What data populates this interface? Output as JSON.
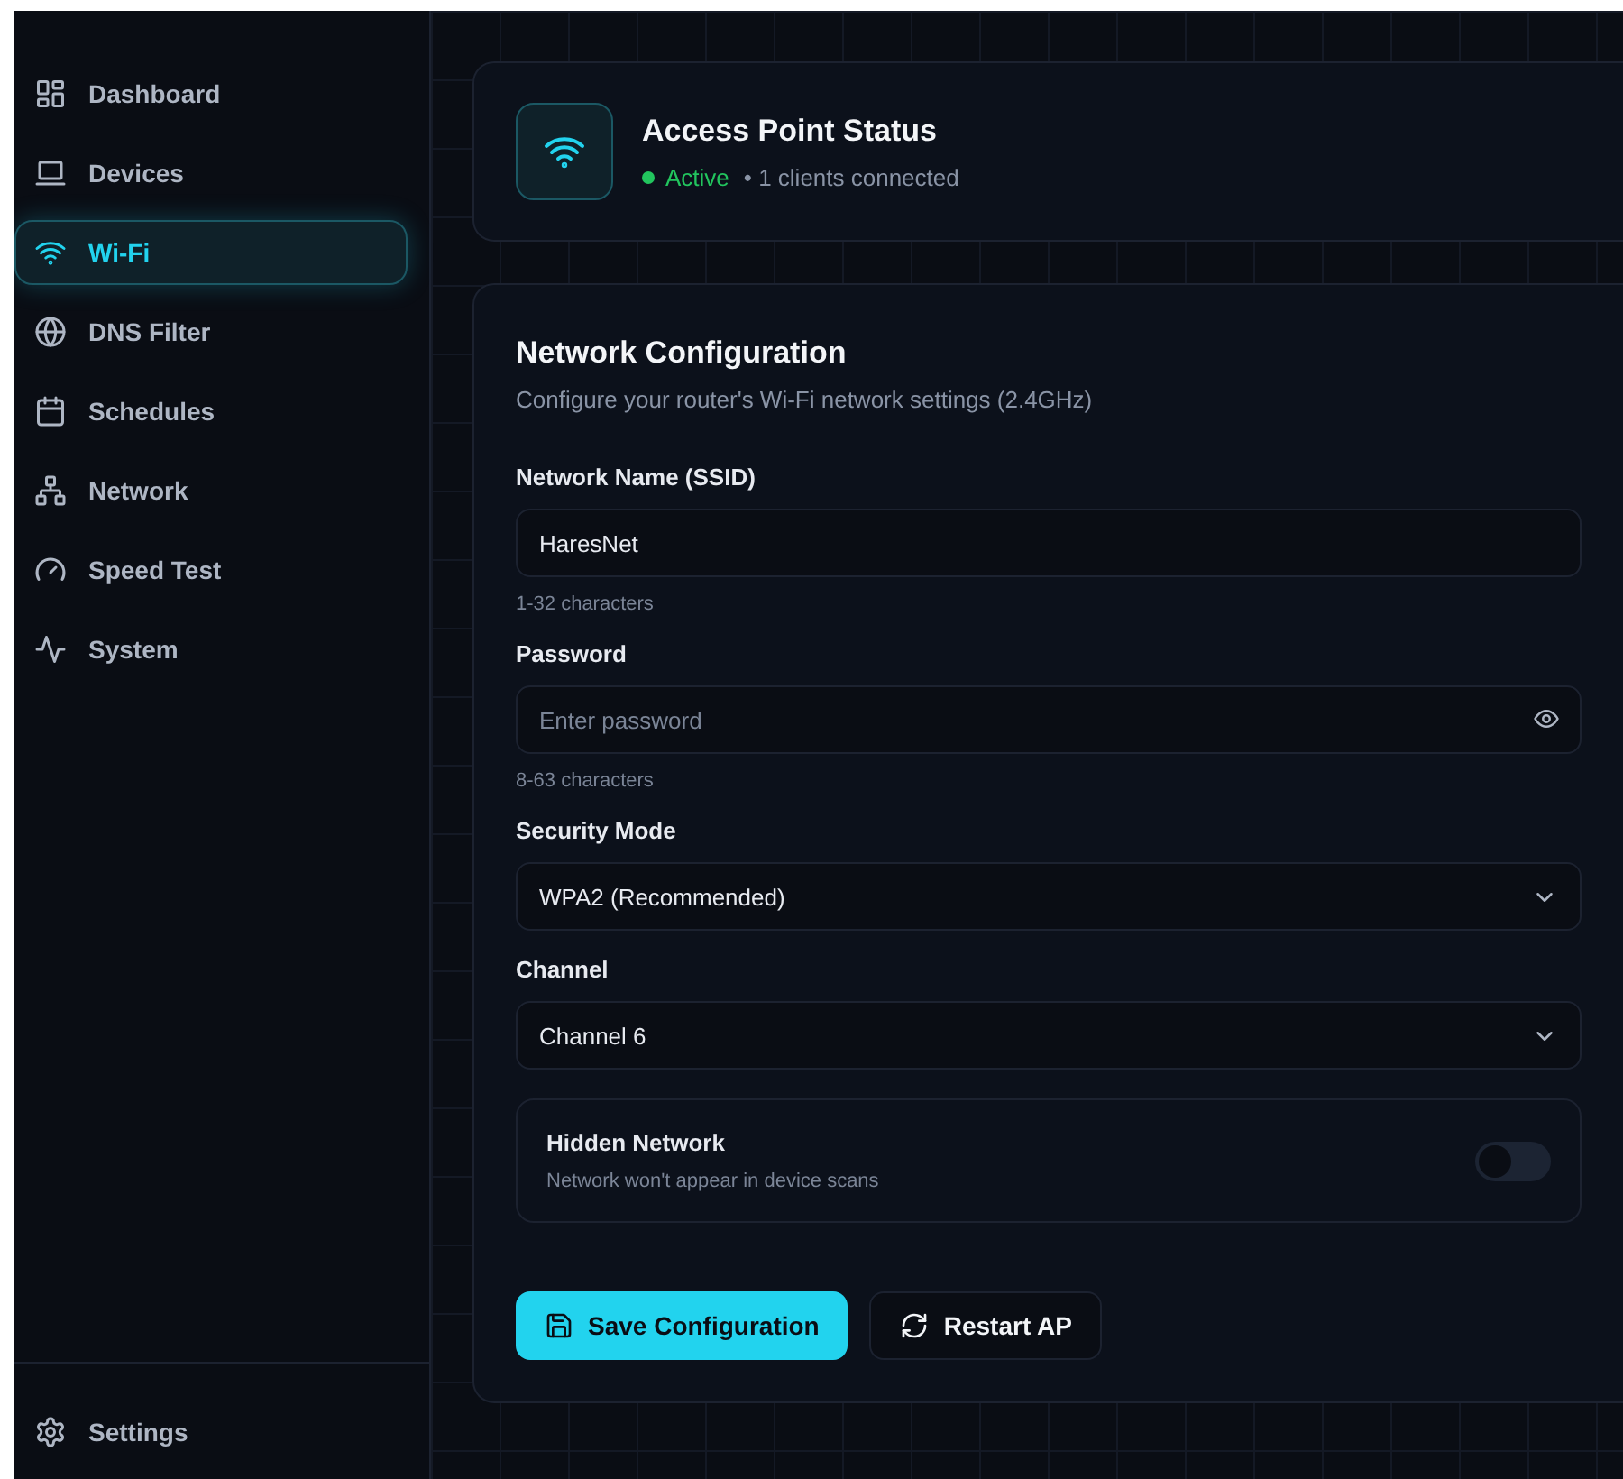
{
  "sidebar": {
    "items": [
      {
        "label": "Dashboard",
        "selected": false
      },
      {
        "label": "Devices",
        "selected": false
      },
      {
        "label": "Wi-Fi",
        "selected": true
      },
      {
        "label": "DNS Filter",
        "selected": false
      },
      {
        "label": "Schedules",
        "selected": false
      },
      {
        "label": "Network",
        "selected": false
      },
      {
        "label": "Speed Test",
        "selected": false
      },
      {
        "label": "System",
        "selected": false
      }
    ],
    "footer": {
      "label": "Settings"
    }
  },
  "status_card": {
    "title": "Access Point Status",
    "status": "Active",
    "active": true,
    "detail": "• 1 clients connected"
  },
  "config": {
    "title": "Network Configuration",
    "subtitle": "Configure your router's Wi-Fi network settings (2.4GHz)",
    "fields": [
      {
        "kind": "text",
        "label": "Network Name (SSID)",
        "value": "HaresNet",
        "hint": "1-32 characters"
      },
      {
        "kind": "password",
        "label": "Password",
        "placeholder": "Enter password",
        "hint": "8-63 characters"
      },
      {
        "kind": "select",
        "label": "Security Mode",
        "value": "WPA2 (Recommended)"
      },
      {
        "kind": "select",
        "label": "Channel",
        "value": "Channel 6"
      }
    ],
    "toggle": {
      "label": "Hidden Network",
      "description": "Network won't appear in device scans",
      "on": false
    },
    "buttons": [
      {
        "label": "Save Configuration",
        "kind": "primary"
      },
      {
        "label": "Restart AP",
        "kind": "secondary"
      }
    ]
  }
}
